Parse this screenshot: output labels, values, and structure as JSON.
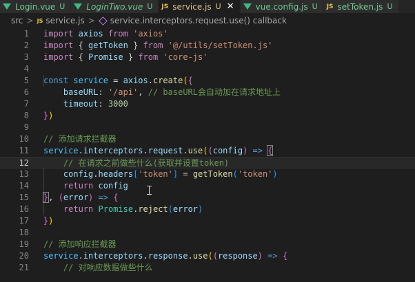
{
  "tabs": [
    {
      "icon": "vue-icon",
      "label": "Login.vue",
      "status": "U",
      "active": false,
      "italic": false
    },
    {
      "icon": "vue-icon",
      "label": "LoginTwo.vue",
      "status": "U",
      "active": false,
      "italic": true
    },
    {
      "icon": "js-icon",
      "label": "service.js",
      "status": "U",
      "active": true,
      "italic": false
    },
    {
      "icon": "vue-icon",
      "label": "vue.config.js",
      "status": "U",
      "active": false,
      "italic": false
    },
    {
      "icon": "js-icon",
      "label": "setToken.js",
      "status": "U",
      "active": false,
      "italic": false
    }
  ],
  "tab_icons": {
    "js": "JS",
    "close": "✕"
  },
  "breadcrumb": {
    "folder": "src",
    "file": "service.js",
    "symbol": "service.interceptors.request.use() callback",
    "separator": ">"
  },
  "editor": {
    "current_line": 12,
    "lines": [
      {
        "n": "1"
      },
      {
        "n": "2"
      },
      {
        "n": "3"
      },
      {
        "n": "4"
      },
      {
        "n": "5"
      },
      {
        "n": "6"
      },
      {
        "n": "7"
      },
      {
        "n": "8"
      },
      {
        "n": "9"
      },
      {
        "n": "10"
      },
      {
        "n": "11"
      },
      {
        "n": "12"
      },
      {
        "n": "13"
      },
      {
        "n": "14"
      },
      {
        "n": "15"
      },
      {
        "n": "16"
      },
      {
        "n": "17"
      },
      {
        "n": "18"
      },
      {
        "n": "19"
      },
      {
        "n": "20"
      },
      {
        "n": "21"
      }
    ],
    "code": {
      "l1": [
        "import",
        " ",
        "axios",
        " ",
        "from",
        " ",
        "'axios'"
      ],
      "l2": [
        "import",
        " { ",
        "getToken",
        " } ",
        "from",
        " ",
        "'@/utils/setToken.js'"
      ],
      "l3": [
        "import",
        " { ",
        "Promise",
        " } ",
        "from",
        " ",
        "'core-js'"
      ],
      "l5": [
        "const",
        " ",
        "service",
        " = ",
        "axios",
        ".",
        "create",
        "(",
        "{"
      ],
      "l6": [
        "    ",
        "baseURL",
        ": ",
        "'/api'",
        ", ",
        "// baseURL会自动加在请求地址上"
      ],
      "l7": [
        "    ",
        "timeout",
        ": ",
        "3000"
      ],
      "l8": [
        "}",
        ")"
      ],
      "l10": [
        "// 添加请求拦截器"
      ],
      "l11": [
        "service",
        ".",
        "interceptors",
        ".",
        "request",
        ".",
        "use",
        "(",
        "(",
        "config",
        ")",
        " => ",
        "{"
      ],
      "l12": [
        "    ",
        "// 在请求之前做些什么(获取并设置token)"
      ],
      "l13": [
        "    ",
        "config",
        ".",
        "headers",
        "[",
        "'token'",
        "]",
        " = ",
        "getToken",
        "(",
        "'token'",
        ")"
      ],
      "l14": [
        "    ",
        "return",
        " ",
        "config"
      ],
      "l15": [
        "}",
        ", ",
        "(",
        "error",
        ")",
        " => ",
        "{"
      ],
      "l16": [
        "    ",
        "return",
        " ",
        "Promise",
        ".",
        "reject",
        "(",
        "error",
        ")"
      ],
      "l17": [
        "}",
        ")"
      ],
      "l19": [
        "// 添加响应拦截器"
      ],
      "l20": [
        "service",
        ".",
        "interceptors",
        ".",
        "response",
        ".",
        "use",
        "(",
        "(",
        "response",
        ")",
        " => ",
        "{"
      ],
      "l21": [
        "    ",
        "// 对响应数据做些什么"
      ]
    }
  },
  "colors": {
    "background": "#1e1e1e",
    "keyword": "#c586c0",
    "storage": "#569cd6",
    "string": "#ce9178",
    "variable": "#4fc1ff",
    "property": "#9cdcfe",
    "function": "#dcdcaa",
    "class": "#4ec9b0",
    "number": "#b5cea8",
    "comment": "#6a9955",
    "untracked": "#73c991",
    "modified": "#e2c08d"
  }
}
